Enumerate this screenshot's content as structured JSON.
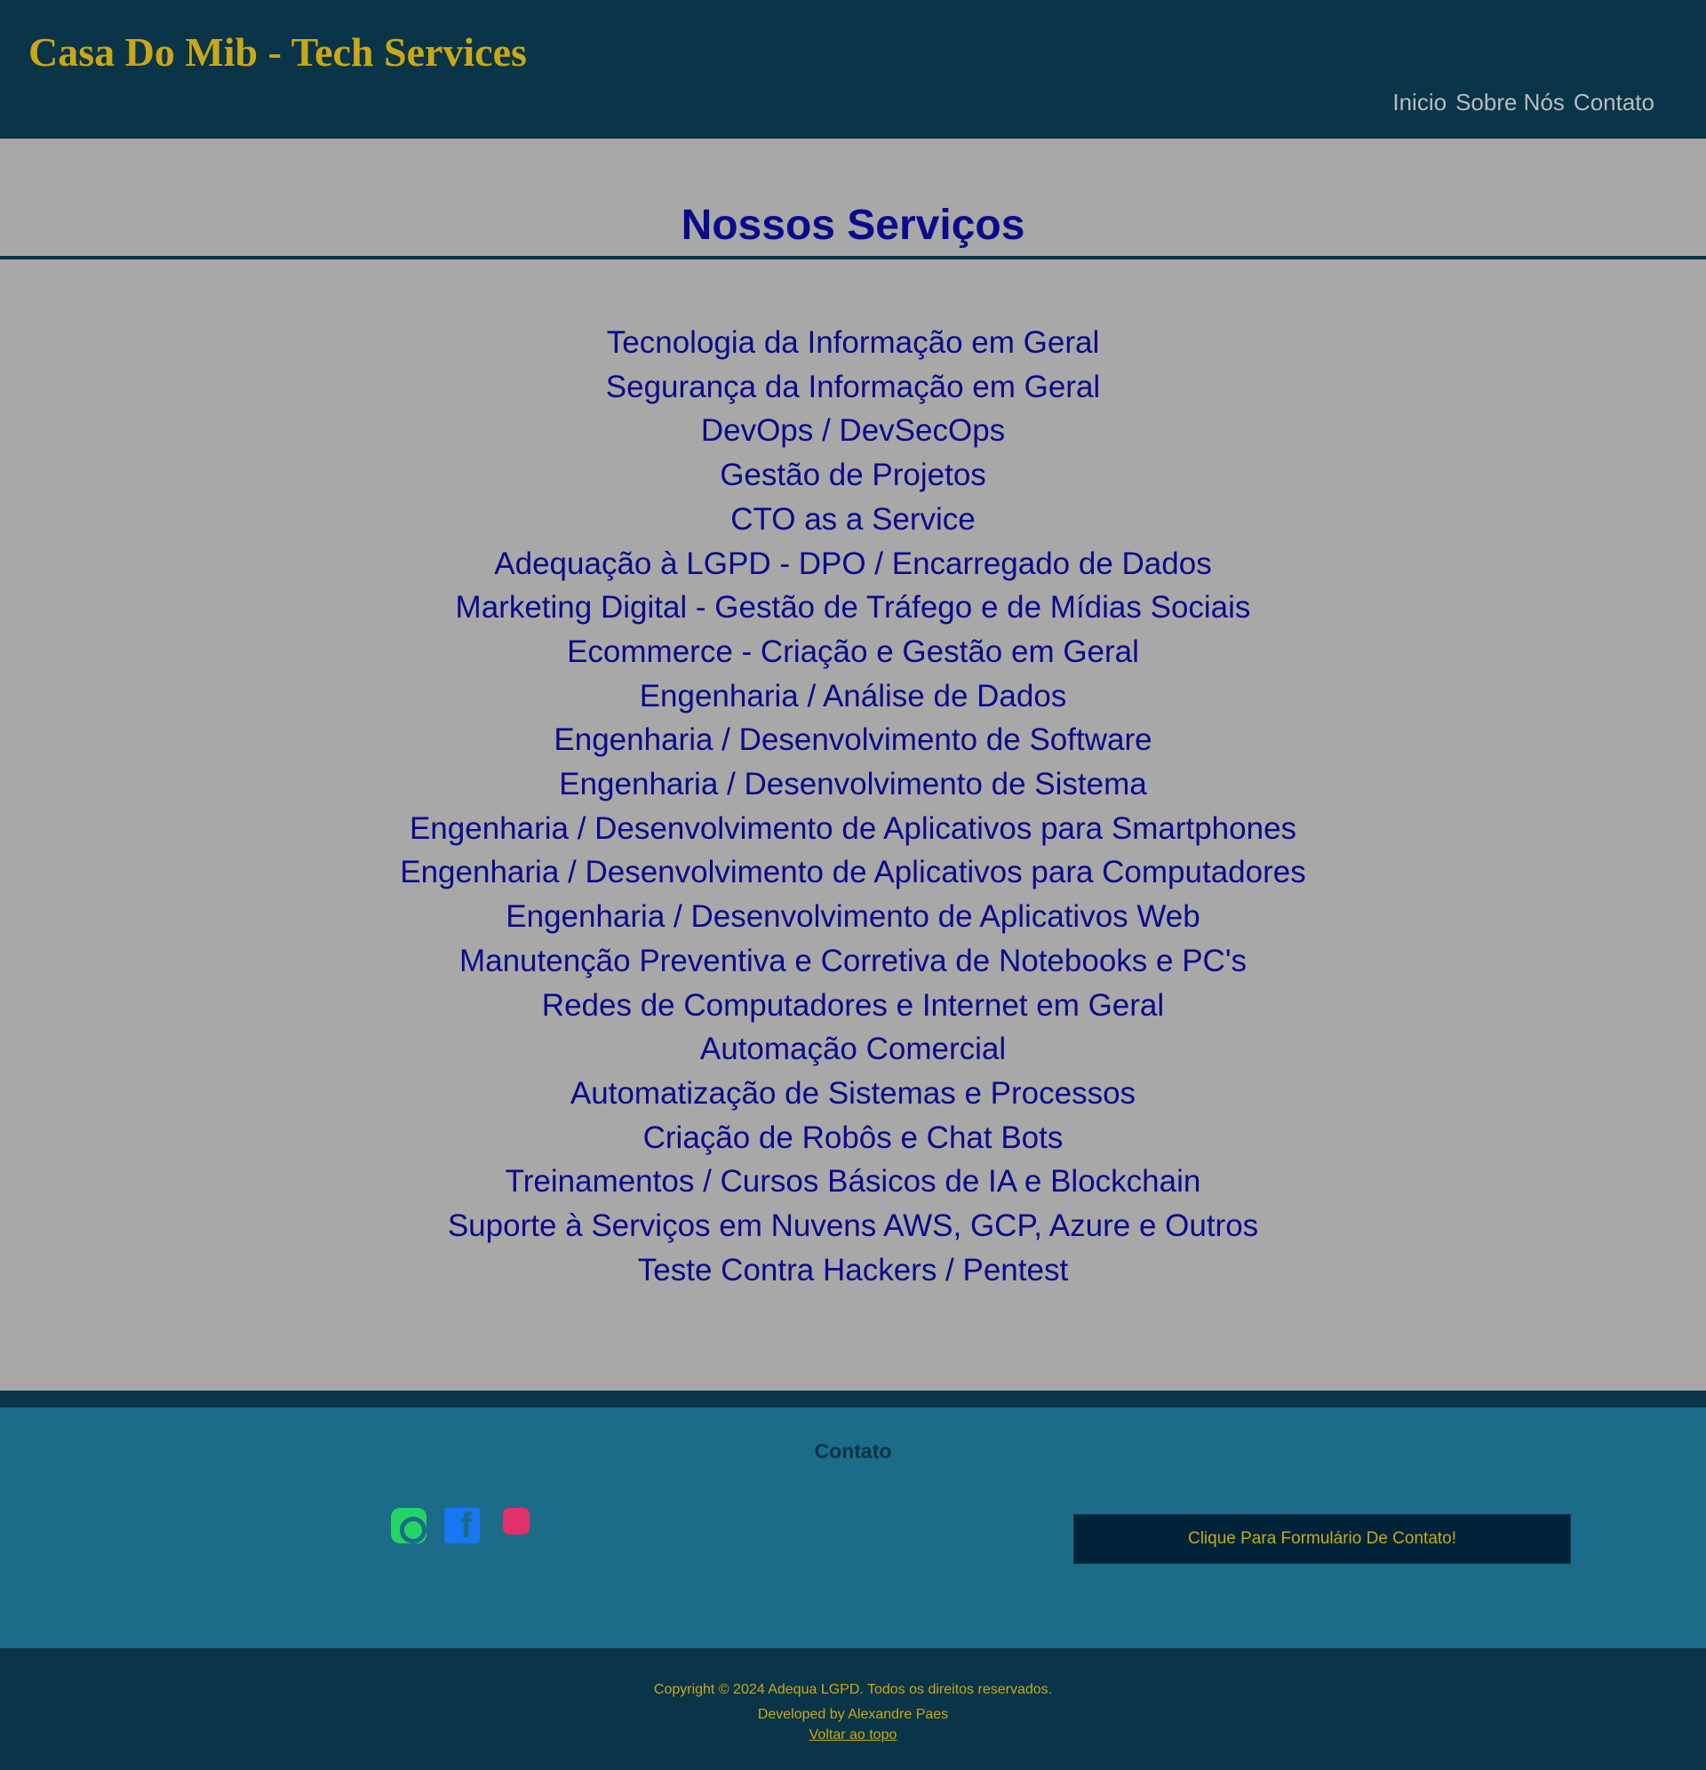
{
  "header": {
    "brand": "Casa Do Mib - Tech Services",
    "nav": [
      "Inicio",
      "Sobre Nós",
      "Contato"
    ]
  },
  "services": {
    "title": "Nossos Serviços",
    "items": [
      "Tecnologia da Informação em Geral",
      "Segurança da Informação em Geral",
      "DevOps / DevSecOps",
      "Gestão de Projetos",
      "CTO as a Service",
      "Adequação à LGPD - DPO / Encarregado de Dados",
      "Marketing Digital - Gestão de Tráfego e de Mídias Sociais",
      "Ecommerce - Criação e Gestão em Geral",
      "Engenharia / Análise de Dados",
      "Engenharia / Desenvolvimento de Software",
      "Engenharia / Desenvolvimento de Sistema",
      "Engenharia / Desenvolvimento de Aplicativos para Smartphones",
      "Engenharia / Desenvolvimento de Aplicativos para Computadores",
      "Engenharia / Desenvolvimento de Aplicativos Web",
      "Manutenção Preventiva e Corretiva de Notebooks e PC's",
      "Redes de Computadores e Internet em Geral",
      "Automação Comercial",
      "Automatização de Sistemas e Processos",
      "Criação de Robôs e Chat Bots",
      "Treinamentos / Cursos Básicos de IA e Blockchain",
      "Suporte à Serviços em Nuvens AWS, GCP, Azure e Outros",
      "Teste Contra Hackers / Pentest"
    ]
  },
  "contact": {
    "title": "Contato",
    "social_icons": [
      "whatsapp-icon",
      "facebook-icon",
      "instagram-icon"
    ],
    "form_button": "Clique Para Formulário De Contato!"
  },
  "footer": {
    "copyright": "Copyright © 2024 Adequa LGPD. Todos os direitos reservados.",
    "developer": "Developed by Alexandre Paes",
    "back_to_top": "Voltar ao topo"
  },
  "colors": {
    "header_bg": "#0a3447",
    "brand": "#c9a71a",
    "body_bg": "#a8a8a8",
    "text_blue": "#0b0b8a",
    "contact_bg": "#1c6b88",
    "button_bg": "#012339"
  }
}
